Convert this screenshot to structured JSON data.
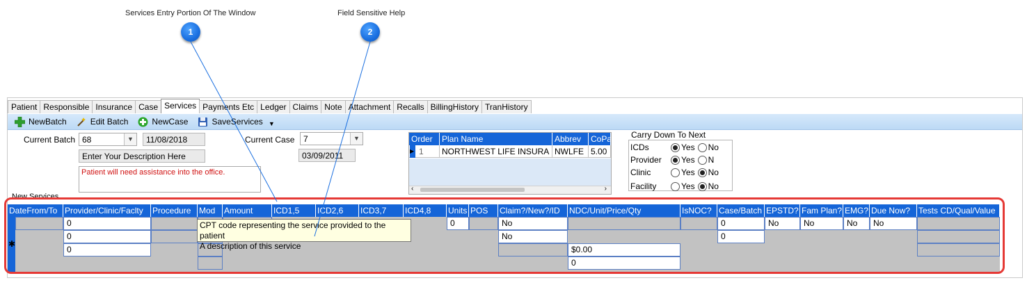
{
  "callouts": [
    {
      "number": "1",
      "label": "Services Entry Portion Of The Window"
    },
    {
      "number": "2",
      "label": "Field Sensitive Help"
    }
  ],
  "tabs": [
    "Patient",
    "Responsible",
    "Insurance",
    "Case",
    "Services",
    "Payments Etc",
    "Ledger",
    "Claims",
    "Note",
    "Attachment",
    "Recalls",
    "BillingHistory",
    "TranHistory"
  ],
  "active_tab": "Services",
  "toolbar": {
    "new_batch": "NewBatch",
    "edit_batch": "Edit Batch",
    "new_case": "NewCase",
    "save_services": "SaveServices"
  },
  "batch": {
    "label": "Current Batch",
    "value": "68",
    "date": "11/08/2018",
    "description": "Enter Your Description Here"
  },
  "case": {
    "label": "Current Case",
    "value": "7",
    "date": "03/09/2011"
  },
  "notes": "Patient will need assistance into the office.",
  "insurance": {
    "columns": [
      "Order",
      "Plan Name",
      "Abbrev",
      "CoPay"
    ],
    "rows": [
      {
        "order": "1",
        "plan": "NORTHWEST LIFE INSURA",
        "abbrev": "NWLFE",
        "copay": "5.00"
      }
    ]
  },
  "carry_down": {
    "title": "Carry Down To Next",
    "rows": [
      {
        "label": "ICDs",
        "yes": "Yes",
        "no": "No",
        "selected": "yes"
      },
      {
        "label": "Provider",
        "yes": "Yes",
        "no": "N",
        "selected": "yes"
      },
      {
        "label": "Clinic",
        "yes": "Yes",
        "no": "No",
        "selected": "no"
      },
      {
        "label": "Facility",
        "yes": "Yes",
        "no": "No",
        "selected": "no"
      }
    ]
  },
  "services": {
    "section_label": "New Services",
    "columns": [
      "DateFrom/To",
      "Provider/Clinic/Faclty",
      "Procedure",
      "Mod",
      "Amount",
      "ICD1,5",
      "ICD2,6",
      "ICD3,7",
      "ICD4,8",
      "Units",
      "POS",
      "Claim?/New?/ID",
      "NDC/Unit/Price/Qty",
      "IsNOC?",
      "Case/Batch",
      "EPSTD?",
      "Fam Plan?",
      "EMG?",
      "Due Now?",
      "Tests CD/Qual/Value"
    ],
    "provider_values": [
      "0",
      "0",
      "0"
    ],
    "units": "0",
    "claim_values": [
      "No",
      "No"
    ],
    "ndc_price": "$0.00",
    "ndc_qty": "0",
    "case_batch_values": [
      "0",
      "0"
    ],
    "epstd": "No",
    "fam_plan": "No",
    "emg": "No",
    "due_now": "No"
  },
  "tooltip": {
    "line1": "CPT code representing the service provided to the patient",
    "line2": "A description of this service"
  }
}
